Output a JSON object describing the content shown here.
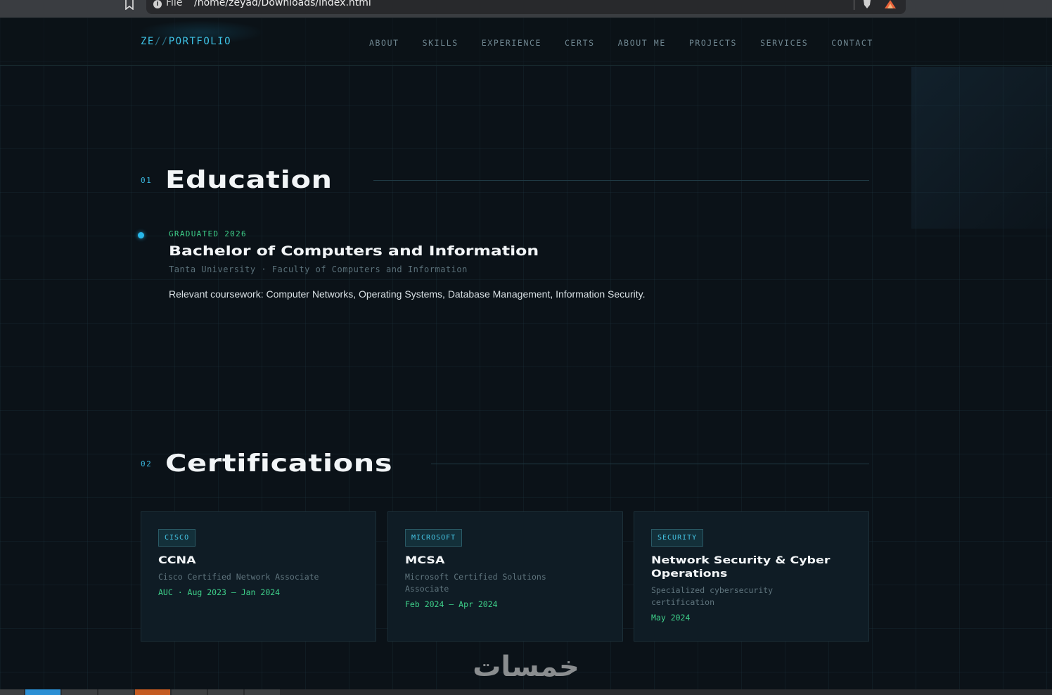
{
  "browser": {
    "url_scheme": "File",
    "url_path": "/home/zeyad/Downloads/index.html"
  },
  "nav": {
    "logo_prefix": "ZE",
    "logo_slashes": "//",
    "logo_suffix": "PORTFOLIO",
    "links": [
      "ABOUT",
      "SKILLS",
      "EXPERIENCE",
      "CERTS",
      "ABOUT ME",
      "PROJECTS",
      "SERVICES",
      "CONTACT"
    ]
  },
  "education": {
    "number": "01",
    "title": "Education",
    "date": "GRADUATED 2026",
    "degree": "Bachelor of Computers and Information",
    "school": "Tanta University · Faculty of Computers and Information",
    "coursework": "Relevant coursework: Computer Networks, Operating Systems, Database Management, Information Security."
  },
  "certifications": {
    "number": "02",
    "title": "Certifications",
    "cards": [
      {
        "tag": "CISCO",
        "title": "CCNA",
        "subtitle": "Cisco Certified Network Associate",
        "date": "AUC · Aug 2023 – Jan 2024"
      },
      {
        "tag": "MICROSOFT",
        "title": "MCSA",
        "subtitle": "Microsoft Certified Solutions Associate",
        "date": "Feb 2024 – Apr 2024"
      },
      {
        "tag": "SECURITY",
        "title": "Network Security & Cyber Operations",
        "subtitle": "Specialized cybersecurity certification",
        "date": "May 2024"
      }
    ]
  },
  "watermark": "خمسات",
  "colors": {
    "accent_cyan": "#3ec3e6",
    "accent_green": "#3ed08a",
    "background": "#0b1218"
  }
}
